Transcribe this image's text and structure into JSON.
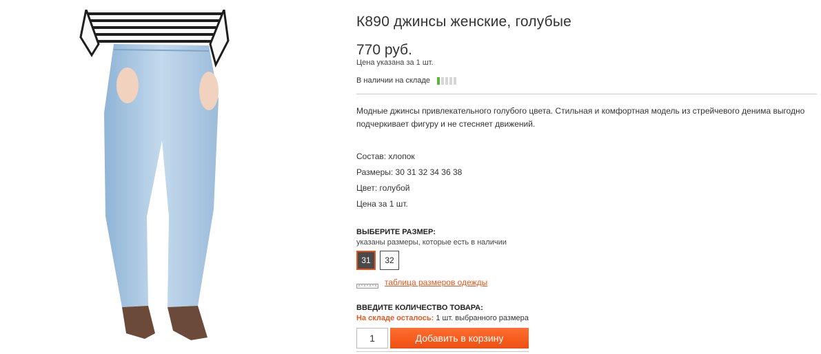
{
  "product": {
    "title": "К890 джинсы женские, голубые",
    "price": "770 руб.",
    "price_note": "Цена указана за 1 шт.",
    "stock_label": "В наличии на складе",
    "stock_level": {
      "filled": 1,
      "total": 5
    },
    "description": "Модные джинсы привлекательного голубого цвета. Стильная и комфортная модель из стрейчевого денима выгодно подчеркивает фигуру и не стесняет движений.",
    "specs": [
      "Состав: хлопок",
      "Размеры: 30 31 32 34 36 38",
      "Цвет: голубой",
      "Цена за 1 шт."
    ]
  },
  "size_selector": {
    "heading": "ВЫБЕРИТЕ РАЗМЕР:",
    "hint": "указаны размеры, которые есть в наличии",
    "options": [
      "31",
      "32"
    ],
    "selected": "31",
    "size_chart_link": "таблица размеров одежды"
  },
  "quantity": {
    "heading": "ВВЕДИТЕ КОЛИЧЕСТВО ТОВАРА:",
    "remaining_label": "На складе осталось:",
    "remaining_text": "1 шт. выбранного размера",
    "value": "1",
    "add_to_cart_label": "Добавить в корзину"
  },
  "colors": {
    "accent": "#e8561c",
    "stock_on": "#5ab53a",
    "stock_off": "#d6d6d6",
    "denim": "#a8c8e2"
  },
  "icons": {
    "ruler": "ruler-icon"
  }
}
